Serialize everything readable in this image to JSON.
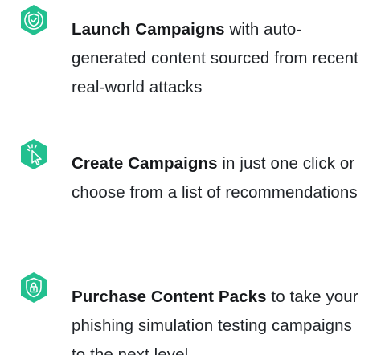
{
  "colors": {
    "icon_fill": "#22c08f",
    "icon_stroke": "#ffffff",
    "title_text": "#17191c",
    "body_text": "#1f2328"
  },
  "features": [
    {
      "icon": "shield-check-icon",
      "title": "Launch Campaigns",
      "description": "with auto-generated content sourced from recent real-world attacks"
    },
    {
      "icon": "cursor-click-icon",
      "title": "Create Campaigns",
      "description": "in just one click or choose from a list of recommendations"
    },
    {
      "icon": "shield-lock-icon",
      "title": "Purchase Content Packs",
      "description": "to take your phishing simulation testing campaigns to the next level"
    }
  ]
}
